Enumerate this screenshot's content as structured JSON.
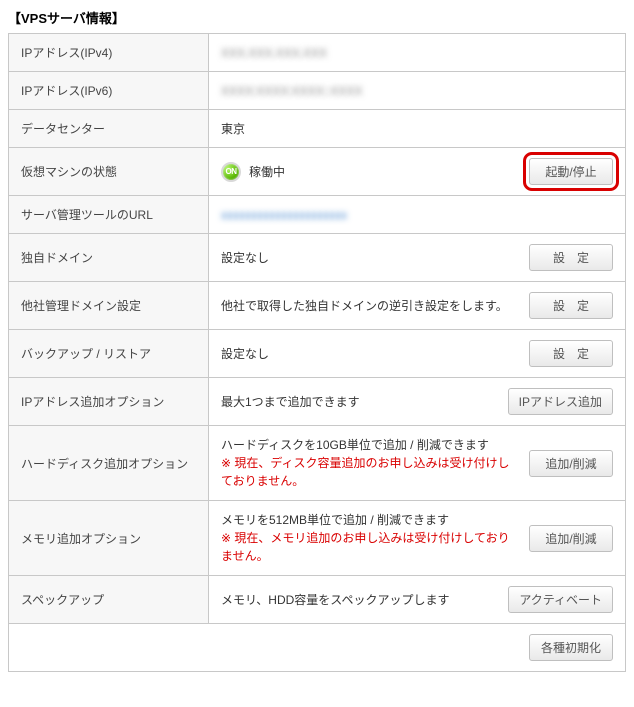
{
  "panel": {
    "title": "【VPSサーバ情報】"
  },
  "rows": {
    "ipv4": {
      "label": "IPアドレス(IPv4)",
      "value": "XXX.XXX.XXX.XXX"
    },
    "ipv6": {
      "label": "IPアドレス(IPv6)",
      "value": "XXXX:XXXX:XXXX::XXXX"
    },
    "dc": {
      "label": "データセンター",
      "value": "東京"
    },
    "vm": {
      "label": "仮想マシンの状態",
      "status_badge": "ON",
      "status_text": "稼働中",
      "button": "起動/停止"
    },
    "tool": {
      "label": "サーバ管理ツールのURL",
      "value": "xxxxxxxxxxxxxxxxxxxxx"
    },
    "domain": {
      "label": "独自ドメイン",
      "value": "設定なし",
      "button": "設　定"
    },
    "other": {
      "label": "他社管理ドメイン設定",
      "value": "他社で取得した独自ドメインの逆引き設定をします。",
      "button": "設　定"
    },
    "backup": {
      "label": "バックアップ / リストア",
      "value": "設定なし",
      "button": "設　定"
    },
    "ipaddon": {
      "label": "IPアドレス追加オプション",
      "value": "最大1つまで追加できます",
      "button": "IPアドレス追加"
    },
    "hdd": {
      "label": "ハードディスク追加オプション",
      "value": "ハードディスクを10GB単位で追加 / 削減できます",
      "warn": "※ 現在、ディスク容量追加のお申し込みは受け付けしておりません。",
      "button": "追加/削減"
    },
    "mem": {
      "label": "メモリ追加オプション",
      "value": "メモリを512MB単位で追加 / 削減できます",
      "warn": "※ 現在、メモリ追加のお申し込みは受け付けしておりません。",
      "button": "追加/削減"
    },
    "spec": {
      "label": "スペックアップ",
      "value": "メモリ、HDD容量をスペックアップします",
      "button": "アクティベート"
    }
  },
  "footer": {
    "reset_button": "各種初期化"
  }
}
